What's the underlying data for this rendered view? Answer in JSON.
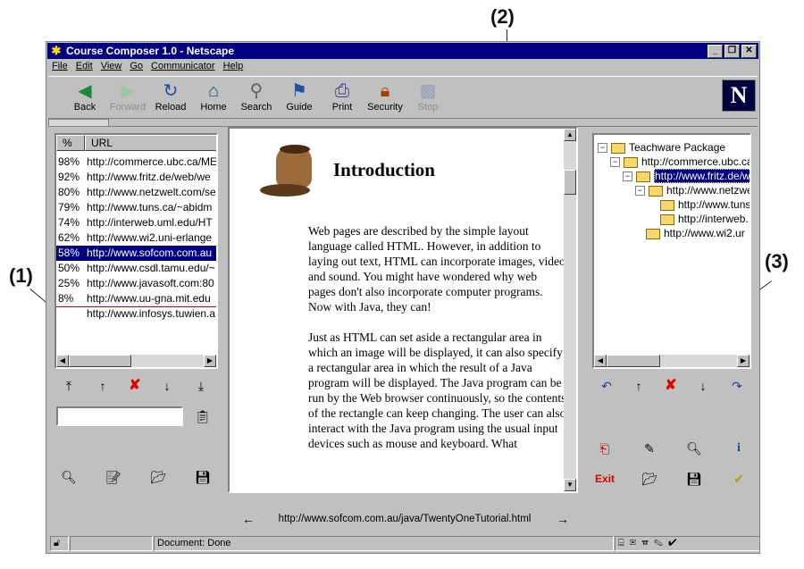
{
  "callouts": {
    "c1": "(1)",
    "c2": "(2)",
    "c3": "(3)"
  },
  "window": {
    "title": "Course Composer 1.0 - Netscape",
    "controls": {
      "minimize": "_",
      "maximize": "❐",
      "close": "✕"
    }
  },
  "menu": {
    "file": "File",
    "edit": "Edit",
    "view": "View",
    "go": "Go",
    "communicator": "Communicator",
    "help": "Help"
  },
  "toolbar": {
    "back": "Back",
    "forward": "Forward",
    "reload": "Reload",
    "home": "Home",
    "search": "Search",
    "guide": "Guide",
    "print": "Print",
    "security": "Security",
    "stop": "Stop",
    "logo": "N"
  },
  "left_panel": {
    "col_percent": "%",
    "col_url": "URL",
    "rows": [
      {
        "percent": "98%",
        "url": "http://commerce.ubc.ca/ME"
      },
      {
        "percent": "92%",
        "url": "http://www.fritz.de/web/we"
      },
      {
        "percent": "80%",
        "url": "http://www.netzwelt.com/se"
      },
      {
        "percent": "79%",
        "url": "http://www.tuns.ca/~abidm"
      },
      {
        "percent": "74%",
        "url": "http://interweb.uml.edu/HT"
      },
      {
        "percent": "62%",
        "url": "http://www.wi2.uni-erlange"
      },
      {
        "percent": "58%",
        "url": "http://www.sofcom.com.au"
      },
      {
        "percent": "50%",
        "url": "http://www.csdl.tamu.edu/~"
      },
      {
        "percent": "25%",
        "url": "http://www.javasoft.com:80"
      },
      {
        "percent": "8%",
        "url": "http://www.uu-gna.mit.edu"
      },
      {
        "percent": "",
        "url": "http://www.infosys.tuwien.a"
      }
    ],
    "selected_index": 6
  },
  "content": {
    "heading": "Introduction",
    "paragraphs": [
      "Web pages are described by the simple layout language called HTML. However, in addition to laying out text, HTML can incorporate images, video and sound.  You might have wondered why web pages don't also incorporate computer programs. Now with Java, they can!",
      "Just as HTML can set aside a rectangular area in which an image will be displayed, it can also specify a rectangular area in which the result of a Java program will be displayed. The Java program can be run by the Web browser continuously, so the contents of the rectangle can keep changing. The user can also interact with the Java program using the usual input devices such as mouse and keyboard. What"
    ],
    "url": "http://www.sofcom.com.au/java/TwentyOneTutorial.html"
  },
  "tree": {
    "root": "Teachware Package",
    "n1": "http://commerce.ubc.ca",
    "n2": "http://www.fritz.de/we",
    "n3": "http://www.netzwe",
    "n4": "http://www.tuns",
    "n5": "http://interweb.",
    "n6": "http://www.wi2.ur"
  },
  "right_tools": {
    "exit": "Exit"
  },
  "status": {
    "text": "Document: Done"
  },
  "colors": {
    "title_bar": "#000080",
    "selection": "#000080",
    "window_face": "#c0c0c0",
    "delete_red": "#e00000"
  }
}
